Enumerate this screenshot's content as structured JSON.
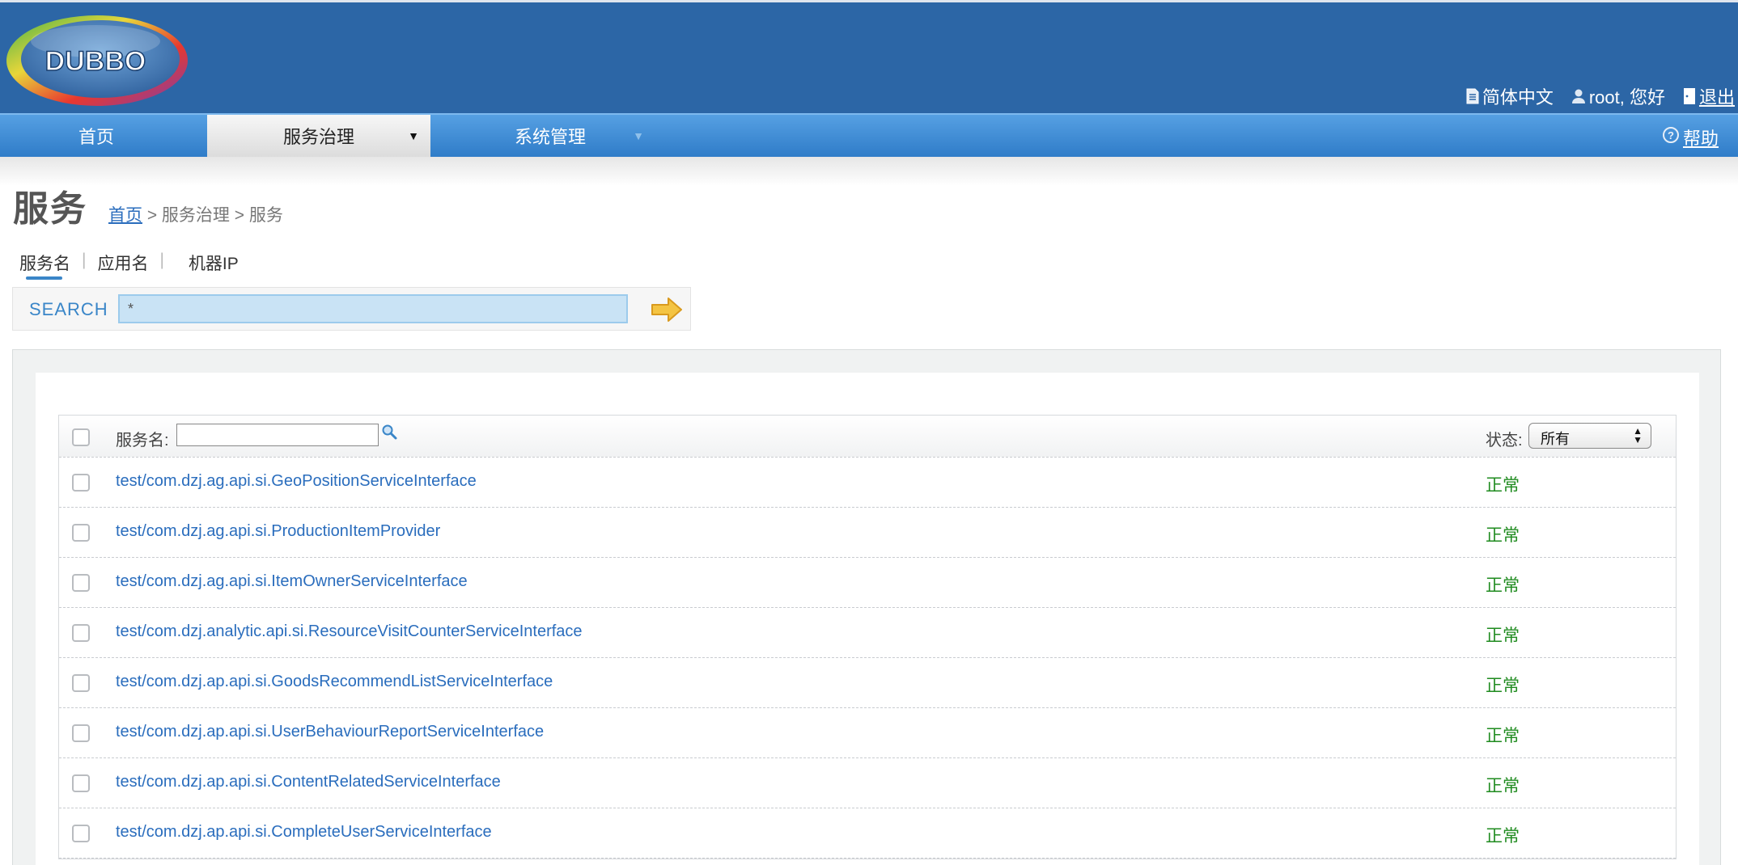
{
  "header": {
    "logo_text": "DUBBO",
    "language_label": "简体中文",
    "user_greeting": "root, 您好",
    "logout_label": "退出"
  },
  "nav": {
    "items": [
      {
        "label": "首页"
      },
      {
        "label": "服务治理"
      },
      {
        "label": "系统管理"
      }
    ],
    "help_label": "帮助"
  },
  "page": {
    "title": "服务",
    "breadcrumb": {
      "home": "首页",
      "rest": " > 服务治理 > 服务"
    }
  },
  "search_tabs": [
    {
      "label": "服务名"
    },
    {
      "label": "应用名"
    },
    {
      "label": "机器IP"
    }
  ],
  "search": {
    "label": "SEARCH",
    "value": "*"
  },
  "table": {
    "name_filter_label": "服务名:",
    "name_filter_value": "",
    "state_label": "状态:",
    "state_selected": "所有",
    "rows": [
      {
        "name": "test/com.dzj.ag.api.si.GeoPositionServiceInterface",
        "status": "正常"
      },
      {
        "name": "test/com.dzj.ag.api.si.ProductionItemProvider",
        "status": "正常"
      },
      {
        "name": "test/com.dzj.ag.api.si.ItemOwnerServiceInterface",
        "status": "正常"
      },
      {
        "name": "test/com.dzj.analytic.api.si.ResourceVisitCounterServiceInterface",
        "status": "正常"
      },
      {
        "name": "test/com.dzj.ap.api.si.GoodsRecommendListServiceInterface",
        "status": "正常"
      },
      {
        "name": "test/com.dzj.ap.api.si.UserBehaviourReportServiceInterface",
        "status": "正常"
      },
      {
        "name": "test/com.dzj.ap.api.si.ContentRelatedServiceInterface",
        "status": "正常"
      },
      {
        "name": "test/com.dzj.ap.api.si.CompleteUserServiceInterface",
        "status": "正常"
      }
    ]
  },
  "colors": {
    "header_bg": "#2c66a6",
    "nav_bg": "#3a86d0",
    "link": "#2a6dbd",
    "status_ok": "#1f8b1f"
  }
}
